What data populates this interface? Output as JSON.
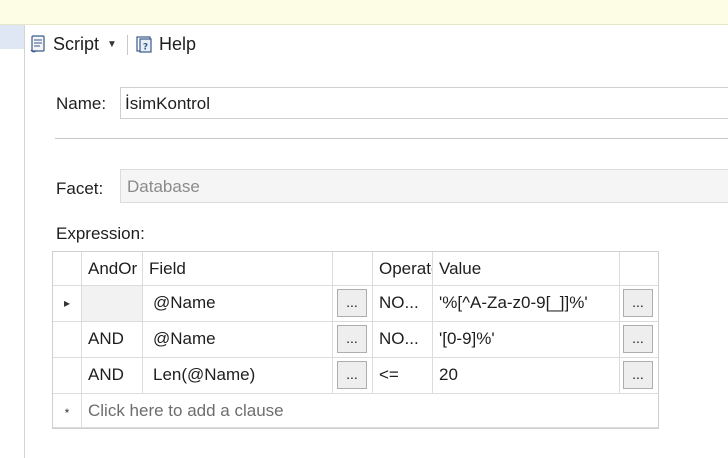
{
  "toolbar": {
    "script_label": "Script",
    "help_label": "Help"
  },
  "form": {
    "name_label": "Name:",
    "name_value": "İsimKontrol",
    "facet_label": "Facet:",
    "facet_value": "Database",
    "expression_label": "Expression:"
  },
  "grid": {
    "columns": [
      "AndOr",
      "Field",
      "Operator",
      "Value"
    ],
    "ellipsis": "...",
    "rows": [
      {
        "andor": "",
        "field": "@Name",
        "operator": "NO...",
        "value": "'%[^A-Za-z0-9[_]]%'"
      },
      {
        "andor": "AND",
        "field": "@Name",
        "operator": "NO...",
        "value": "'[0-9]%'"
      },
      {
        "andor": "AND",
        "field": "Len(@Name)",
        "operator": "<=",
        "value": "20"
      }
    ],
    "current_row_marker": "▸",
    "new_row_marker": "*",
    "add_clause_text": "Click here to add a clause"
  },
  "colors": {
    "topbar": "#fdfde6",
    "selection": "#dfe6f4",
    "disabled_text": "#8a8a8a"
  }
}
